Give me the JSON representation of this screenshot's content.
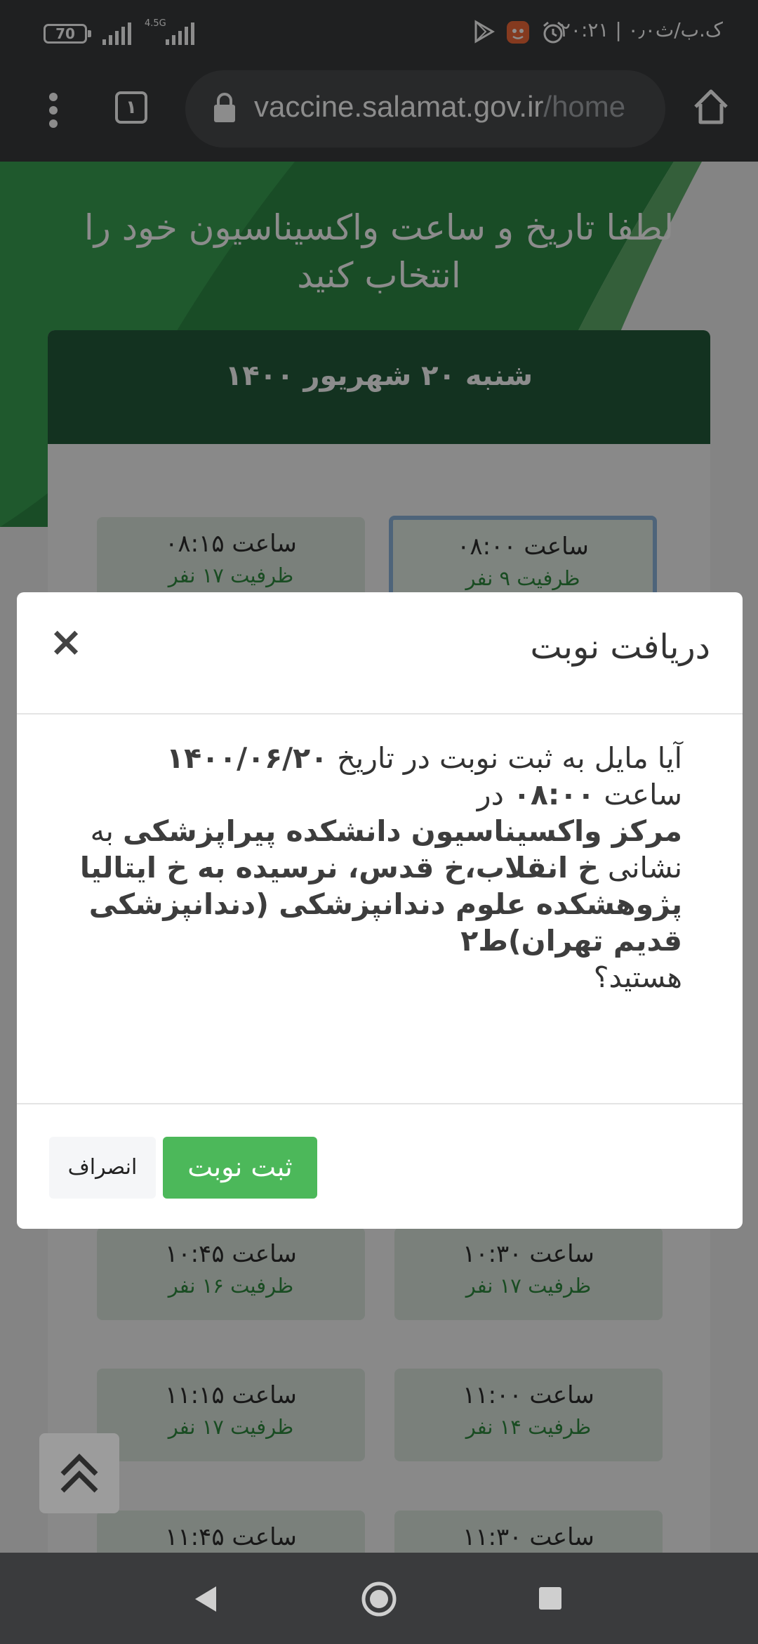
{
  "status_bar": {
    "time": "۲۰:۲۱ | ۰٫۰ک.ب/ث",
    "battery": "70",
    "network": "4.5G"
  },
  "browser": {
    "url_host": "vaccine.salamat.gov.ir",
    "url_path": "/home",
    "tab_count": "۱"
  },
  "page": {
    "title": "لطفا تاریخ و ساعت واکسیناسیون خود را انتخاب کنید",
    "date_header": "شنبه ۲۰ شهریور ۱۴۰۰",
    "slots": [
      {
        "time": "ساعت ۰۸:۰۰",
        "capacity": "ظرفیت ۹ نفر",
        "selected": true
      },
      {
        "time": "ساعت ۰۸:۱۵",
        "capacity": "ظرفیت ۱۷ نفر",
        "selected": false
      },
      {
        "time": "ساعت ۱۰:۳۰",
        "capacity": "ظرفیت ۱۷ نفر",
        "selected": false
      },
      {
        "time": "ساعت ۱۰:۴۵",
        "capacity": "ظرفیت ۱۶ نفر",
        "selected": false
      },
      {
        "time": "ساعت ۱۱:۰۰",
        "capacity": "ظرفیت ۱۴ نفر",
        "selected": false
      },
      {
        "time": "ساعت ۱۱:۱۵",
        "capacity": "ظرفیت ۱۷ نفر",
        "selected": false
      },
      {
        "time": "ساعت ۱۱:۳۰",
        "capacity": "",
        "selected": false
      },
      {
        "time": "ساعت ۱۱:۴۵",
        "capacity": "",
        "selected": false
      }
    ]
  },
  "modal": {
    "title": "دریافت نوبت",
    "close_icon": "×",
    "line1_prefix": "آیا مایل به ثبت نوبت در تاریخ",
    "date": "۱۴۰۰/۰۶/۲۰",
    "line2_prefix": "ساعت",
    "time": "۰۸:۰۰",
    "line2_suffix": "در",
    "center": "مرکز واکسیناسیون دانشکده پیراپزشکی",
    "address_prefix": "به نشانی",
    "address": "خ انقلاب،خ قدس، نرسیده به خ ایتالیا پژوهشکده علوم دندانپزشکی (دندانپزشکی قدیم تهران)ط۲",
    "question_end": "هستید؟",
    "confirm_label": "ثبت نوبت",
    "cancel_label": "انصراف"
  },
  "colors": {
    "brand_green": "#2e8b46",
    "header_green": "#235b3b",
    "confirm_green": "#4cb85a",
    "capacity_green": "#2f8a3f"
  },
  "icons": {
    "scroll_top": "double-chevron-up-icon",
    "home": "home-icon",
    "lock": "lock-icon",
    "menu": "more-vert-icon"
  }
}
